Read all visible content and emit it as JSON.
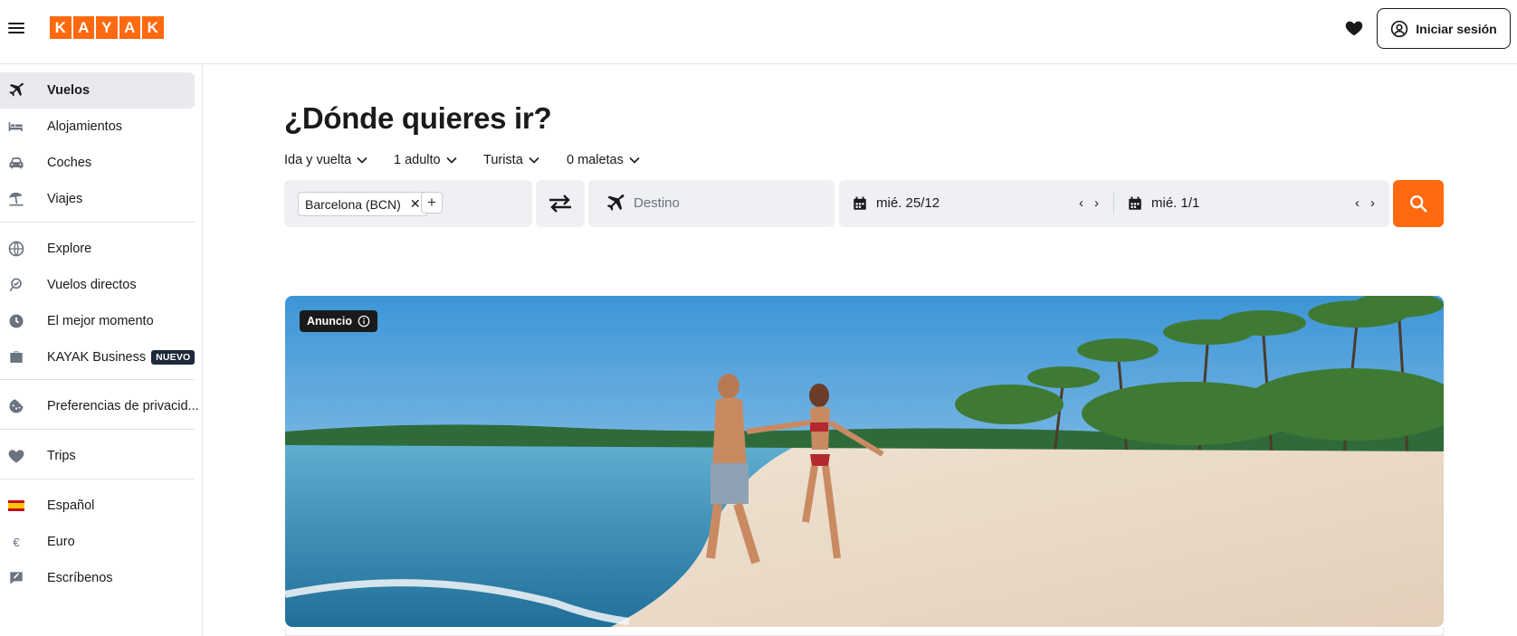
{
  "brand": {
    "logo_letters": [
      "K",
      "A",
      "Y",
      "A",
      "K"
    ],
    "accent": "#ff690f"
  },
  "header": {
    "menu_icon": "hamburger-icon",
    "favorites_icon": "heart-icon",
    "signin_label": "Iniciar sesión",
    "signin_icon": "user-circle-icon"
  },
  "sidebar": {
    "items": [
      {
        "label": "Vuelos",
        "icon": "plane-icon",
        "active": true
      },
      {
        "label": "Alojamientos",
        "icon": "bed-icon"
      },
      {
        "label": "Coches",
        "icon": "car-icon"
      },
      {
        "label": "Viajes",
        "icon": "beach-umbrella-icon"
      },
      {
        "label": "Explore",
        "icon": "globe-icon"
      },
      {
        "label": "Vuelos directos",
        "icon": "direct-flights-icon"
      },
      {
        "label": "El mejor momento",
        "icon": "clock-icon"
      },
      {
        "label": "KAYAK Business",
        "icon": "briefcase-icon",
        "badge": "NUEVO"
      },
      {
        "label": "Preferencias de privacid...",
        "icon": "cookie-icon"
      },
      {
        "label": "Trips",
        "icon": "heart-icon"
      },
      {
        "label": "Español",
        "icon": "spain-flag-icon"
      },
      {
        "label": "Euro",
        "icon": "euro-icon"
      },
      {
        "label": "Escríbenos",
        "icon": "feedback-icon"
      }
    ]
  },
  "search": {
    "title": "¿Dónde quieres ir?",
    "options": {
      "trip_type": "Ida y vuelta",
      "travelers": "1 adulto",
      "cabin": "Turista",
      "bags": "0 maletas"
    },
    "origin_chip": "Barcelona (BCN)",
    "destination_placeholder": "Destino",
    "depart_date": "mié. 25/12",
    "return_date": "mié. 1/1"
  },
  "ad": {
    "label": "Anuncio",
    "colors": {
      "sky_top": "#4a9fd8",
      "sea": "#2c7aa8",
      "sand": "#e8d9c6"
    }
  }
}
